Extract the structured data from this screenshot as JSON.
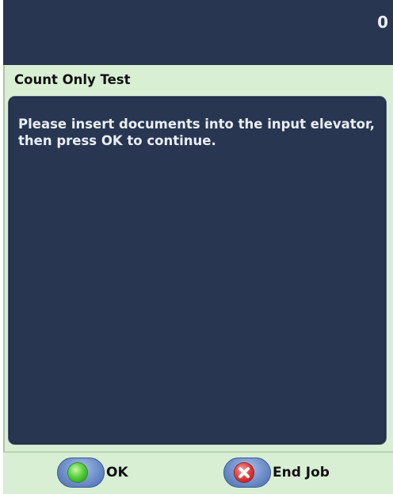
{
  "status_bar": {
    "counter": "0",
    "background_color": "#283651"
  },
  "dialog": {
    "title": "Count Only Test",
    "message": "Please insert documents into the input elevator, then press OK to continue.",
    "frame_color": "#d9efd4",
    "panel_color": "#283651"
  },
  "buttons": {
    "ok": {
      "label": "OK",
      "icon": "green-circle-icon",
      "icon_color": "#57d13a"
    },
    "end_job": {
      "label": "End Job",
      "icon": "red-x-icon",
      "icon_color": "#e23b3b"
    }
  }
}
